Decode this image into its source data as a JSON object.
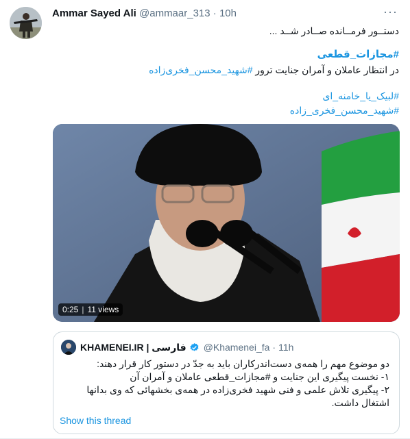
{
  "tweet": {
    "author_name": "Ammar Sayed Ali",
    "handle": "@ammaar_313",
    "dot": "·",
    "time": "10h",
    "more": "···",
    "line1": "دستــور فرمــانده صــادر شــد ...",
    "main_hashtag": "#مجازات_قطعی",
    "line3_text": "در انتظار عاملان و آمران جنایت ترور ",
    "line3_link": "#شهید_محسن_فخری‌زاده",
    "tag4": "#لبیک_یا_خامنه_ای",
    "tag5": "#شهید_محسن_فخری_زاده"
  },
  "media": {
    "duration": "0:25",
    "views": "11 views"
  },
  "quote": {
    "name": "KHAMENEI.IR | فارسی",
    "handle": "@Khamenei_fa",
    "dot": "·",
    "time": "11h",
    "lines": [
      "دو موضوع مهم را همه‌ی دست‌اندرکاران باید به جدّ در دستور کار قرار دهند:",
      "۱- نخست پیگیری این جنایت و #مجازات_قطعی عاملان و آمران آن",
      "۲- پیگیری تلاش علمی و فنی شهید فخری‌زاده در همه‌ی بخشهائی که وی بدانها",
      "اشتغال داشت."
    ],
    "show_thread": "Show this thread"
  },
  "colors": {
    "link": "#1b95e0",
    "secondary": "#5b7083",
    "border": "#cfd9de"
  },
  "icons": {
    "more": "more-dots-icon",
    "verified": "verified-badge-icon"
  }
}
